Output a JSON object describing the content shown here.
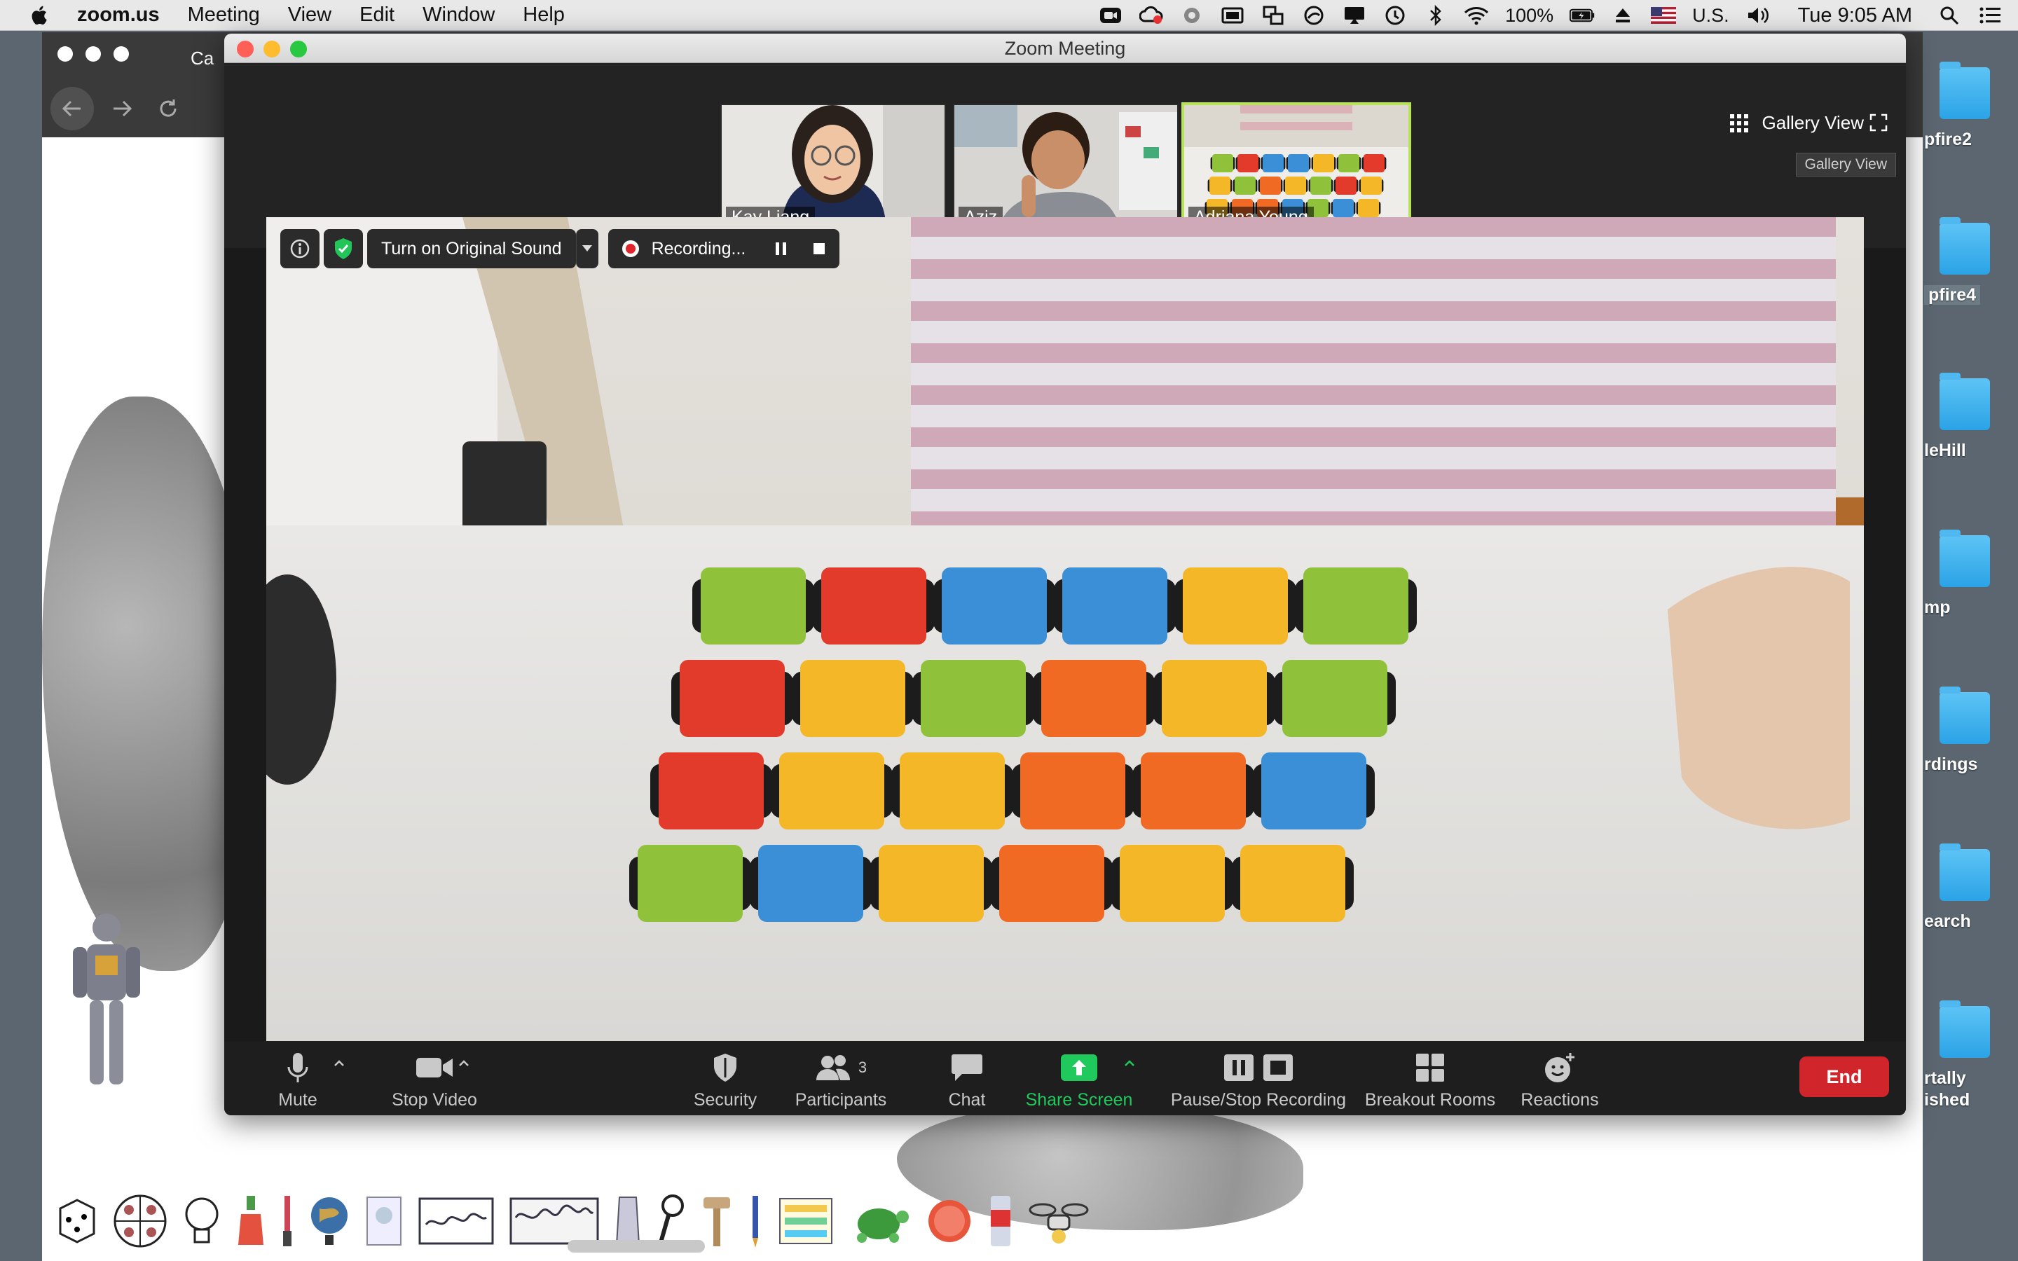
{
  "menubar": {
    "app_name": "zoom.us",
    "menus": [
      "Meeting",
      "View",
      "Edit",
      "Window",
      "Help"
    ],
    "battery": "100%",
    "input_source": "U.S.",
    "clock": "Tue 9:05 AM"
  },
  "desktop": {
    "items": [
      {
        "label": "pfire2"
      },
      {
        "label": "pfire4"
      },
      {
        "label": "leHill"
      },
      {
        "label": "mp"
      },
      {
        "label": "rdings"
      },
      {
        "label": "earch"
      },
      {
        "label": "rtally"
      },
      {
        "label": "ished"
      }
    ]
  },
  "browser": {
    "tab_stub": "Ca"
  },
  "zoom": {
    "window_title": "Zoom Meeting",
    "participants": [
      {
        "name": "Kay Liang"
      },
      {
        "name": "Aziz"
      },
      {
        "name": "Adriana Young"
      }
    ],
    "gallery_view_label": "Gallery View",
    "gallery_view_tooltip": "Gallery View",
    "video_toolbar": {
      "original_sound": "Turn on Original Sound",
      "recording": "Recording..."
    },
    "controls": {
      "mute": "Mute",
      "stop_video": "Stop Video",
      "security": "Security",
      "participants": "Participants",
      "participants_count": "3",
      "chat": "Chat",
      "share_screen": "Share Screen",
      "pause_stop_recording": "Pause/Stop Recording",
      "breakout_rooms": "Breakout Rooms",
      "reactions": "Reactions",
      "end": "End"
    },
    "colors": {
      "share_green": "#20c95b",
      "end_red": "#d0262b",
      "active_speaker": "#b7e35a"
    }
  }
}
